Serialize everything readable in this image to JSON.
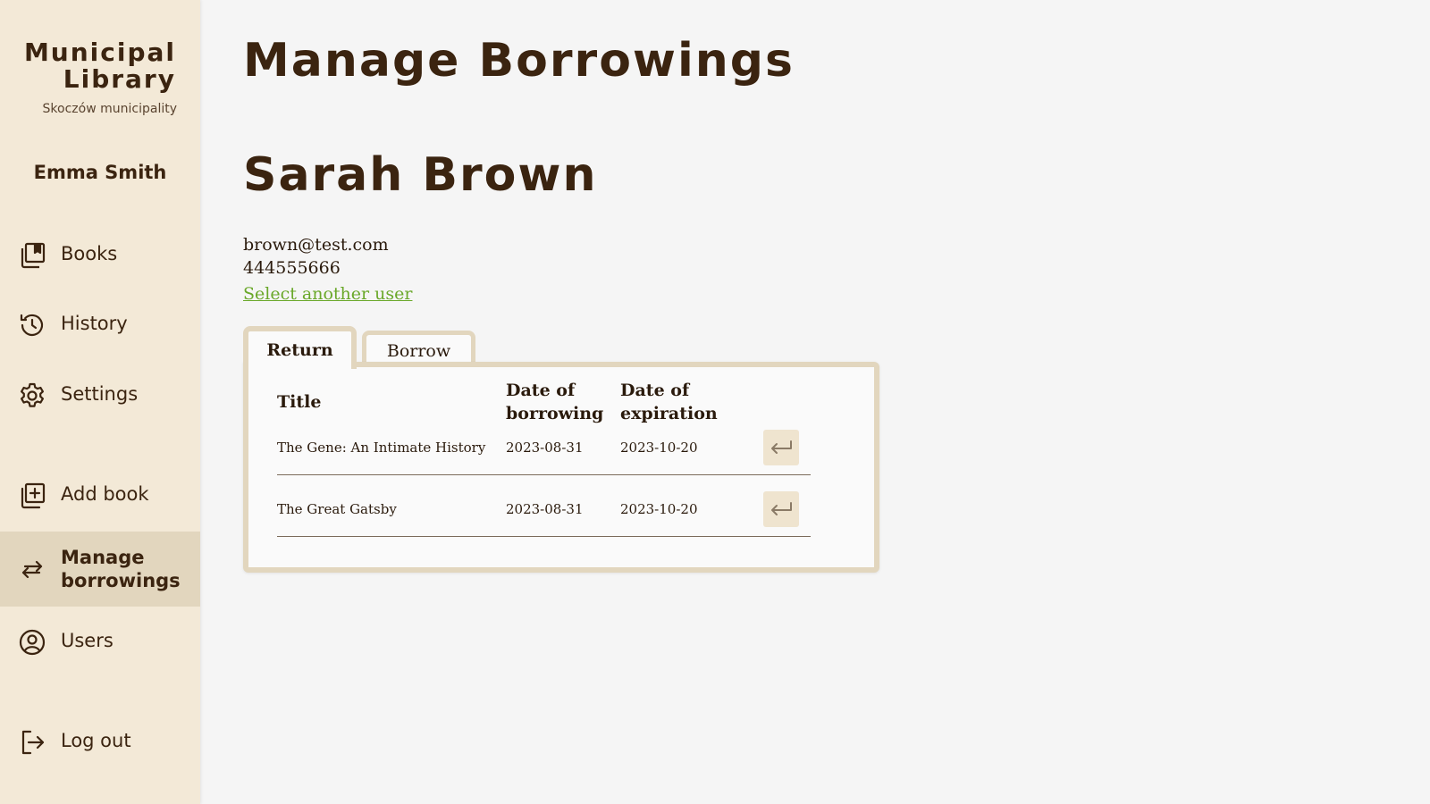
{
  "sidebar": {
    "brand_line1": "Municipal",
    "brand_line2": "Library",
    "brand_sub": "Skoczów municipality",
    "current_user": "Emma Smith",
    "items": [
      {
        "label": "Books",
        "icon": "books-icon"
      },
      {
        "label": "History",
        "icon": "history-icon"
      },
      {
        "label": "Settings",
        "icon": "gear-icon"
      },
      {
        "label": "Add book",
        "icon": "add-book-icon"
      },
      {
        "label_line1": "Manage",
        "label_line2": "borrowings",
        "icon": "swap-arrows-icon",
        "active": true
      },
      {
        "label": "Users",
        "icon": "user-circle-icon"
      },
      {
        "label": "Log out",
        "icon": "logout-icon"
      }
    ]
  },
  "main": {
    "title": "Manage Borrowings",
    "user": {
      "name": "Sarah Brown",
      "email": "brown@test.com",
      "phone": "444555666",
      "select_link": "Select another user"
    },
    "tabs": [
      {
        "label": "Return",
        "active": true
      },
      {
        "label": "Borrow",
        "active": false
      }
    ],
    "table": {
      "headers": {
        "title": "Title",
        "borrowed_line1": "Date of",
        "borrowed_line2": "borrowing",
        "expiration_line1": "Date of",
        "expiration_line2": "expiration"
      },
      "rows": [
        {
          "title": "The Gene: An Intimate History",
          "borrowed": "2023-08-31",
          "expiration": "2023-10-20",
          "action_icon": "return-arrow-icon"
        },
        {
          "title": "The Great Gatsby",
          "borrowed": "2023-08-31",
          "expiration": "2023-10-20",
          "action_icon": "return-arrow-icon"
        }
      ]
    }
  },
  "colors": {
    "sidebar_bg": "#f3e9d7",
    "sidebar_active": "#e2d6be",
    "text_dark": "#3b2410",
    "link_green": "#6aa82a",
    "page_bg": "#f5f5f5"
  }
}
